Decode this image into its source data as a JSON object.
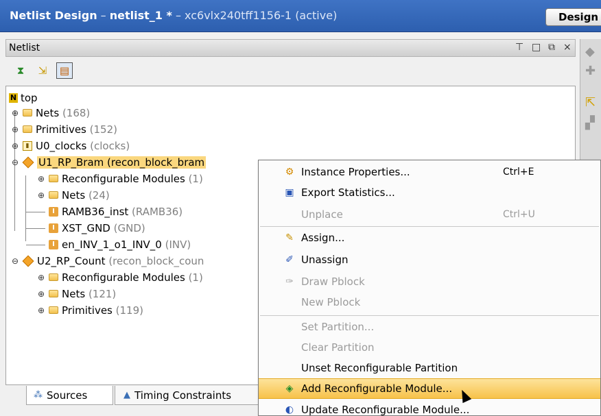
{
  "titlebar": {
    "title_bold_prefix": "Netlist Design",
    "dash": " – ",
    "netlist_name": "netlist_1 *",
    "part": " – xc6vlx240tff1156-1 (active)",
    "design_button": "Design"
  },
  "panel": {
    "title": "Netlist",
    "controls": {
      "pin": "⊤",
      "max": "□",
      "float": "⧉",
      "close": "×"
    }
  },
  "toolbar": {
    "buttons": [
      {
        "icon": "collapse-all-icon",
        "glyph": "⧗"
      },
      {
        "icon": "expand-all-icon",
        "glyph": "⇲"
      },
      {
        "icon": "show-hierarchy-icon",
        "glyph": "▤"
      }
    ]
  },
  "tree": {
    "root": "top",
    "nets": {
      "label": "Nets",
      "count": "(168)"
    },
    "primitives": {
      "label": "Primitives",
      "count": "(152)"
    },
    "u0": {
      "label": "U0_clocks",
      "type": "(clocks)"
    },
    "u1": {
      "label": "U1_RP_Bram (recon_block_bram",
      "children": {
        "reconf": {
          "label": "Reconfigurable Modules",
          "count": "(1)"
        },
        "nets": {
          "label": "Nets",
          "count": "(24)"
        },
        "ramb": {
          "label": "RAMB36_inst",
          "type": "(RAMB36)"
        },
        "gnd": {
          "label": "XST_GND",
          "type": "(GND)"
        },
        "inv": {
          "label": "en_INV_1_o1_INV_0",
          "type": "(INV)"
        }
      }
    },
    "u2": {
      "label": "U2_RP_Count",
      "type": "(recon_block_coun",
      "children": {
        "reconf": {
          "label": "Reconfigurable Modules",
          "count": "(1)"
        },
        "nets": {
          "label": "Nets",
          "count": "(121)"
        },
        "prims": {
          "label": "Primitives",
          "count": "(119)"
        }
      }
    }
  },
  "tabs": {
    "sources": "Sources",
    "timing": "Timing Constraints"
  },
  "menu": {
    "items": [
      {
        "label": "Instance Properties...",
        "shortcut": "Ctrl+E"
      },
      {
        "label": "Export Statistics..."
      },
      {
        "label": "Unplace",
        "shortcut": "Ctrl+U"
      },
      {
        "label": "Assign..."
      },
      {
        "label": "Unassign"
      },
      {
        "label": "Draw Pblock"
      },
      {
        "label": "New Pblock"
      },
      {
        "label": "Set Partition..."
      },
      {
        "label": "Clear Partition"
      },
      {
        "label": "Unset Reconfigurable Partition"
      },
      {
        "label": "Add Reconfigurable Module..."
      },
      {
        "label": "Update Reconfigurable Module..."
      }
    ]
  }
}
